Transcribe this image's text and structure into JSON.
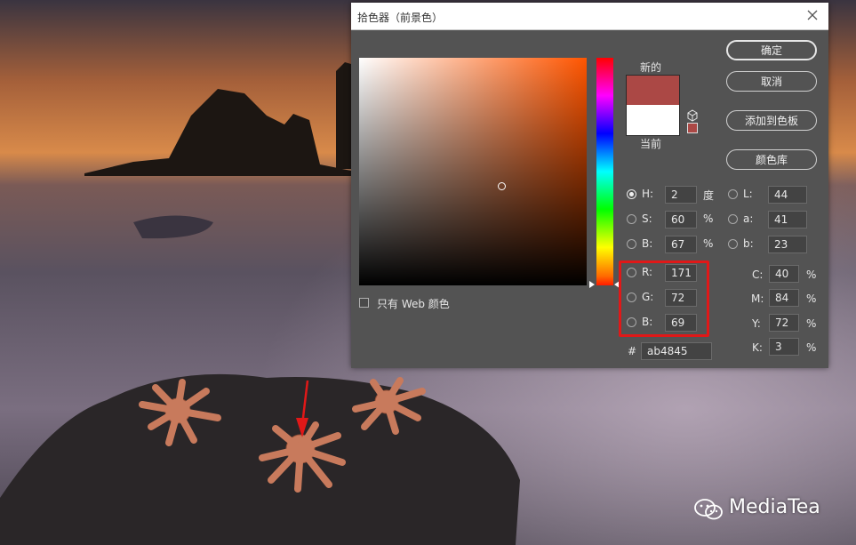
{
  "dialog": {
    "title": "拾色器（前景色）",
    "new_label": "新的",
    "current_label": "当前",
    "new_color": "#ab4845",
    "current_color": "#ffffff",
    "buttons": {
      "ok": "确定",
      "cancel": "取消",
      "add_to_swatches": "添加到色板",
      "color_libraries": "颜色库"
    },
    "hsb": {
      "h": {
        "label": "H:",
        "value": "2",
        "unit": "度"
      },
      "s": {
        "label": "S:",
        "value": "60",
        "unit": "%"
      },
      "b": {
        "label": "B:",
        "value": "67",
        "unit": "%"
      }
    },
    "lab": {
      "l": {
        "label": "L:",
        "value": "44"
      },
      "a": {
        "label": "a:",
        "value": "41"
      },
      "b": {
        "label": "b:",
        "value": "23"
      }
    },
    "rgb": {
      "r": {
        "label": "R:",
        "value": "171"
      },
      "g": {
        "label": "G:",
        "value": "72"
      },
      "b": {
        "label": "B:",
        "value": "69"
      }
    },
    "cmyk": {
      "c": {
        "label": "C:",
        "value": "40",
        "unit": "%"
      },
      "m": {
        "label": "M:",
        "value": "84",
        "unit": "%"
      },
      "y": {
        "label": "Y:",
        "value": "72",
        "unit": "%"
      },
      "k": {
        "label": "K:",
        "value": "3",
        "unit": "%"
      }
    },
    "hex": {
      "label": "#",
      "value": "ab4845"
    },
    "web_only_label": "只有 Web 颜色",
    "selected_mode": "H"
  },
  "watermark": {
    "text": "MediaTea"
  },
  "icons": [
    "close-icon",
    "cube-icon",
    "wechat-icon",
    "red-arrow"
  ],
  "colors": {
    "highlight_box": "#e01818",
    "dialog_bg": "#535353"
  }
}
